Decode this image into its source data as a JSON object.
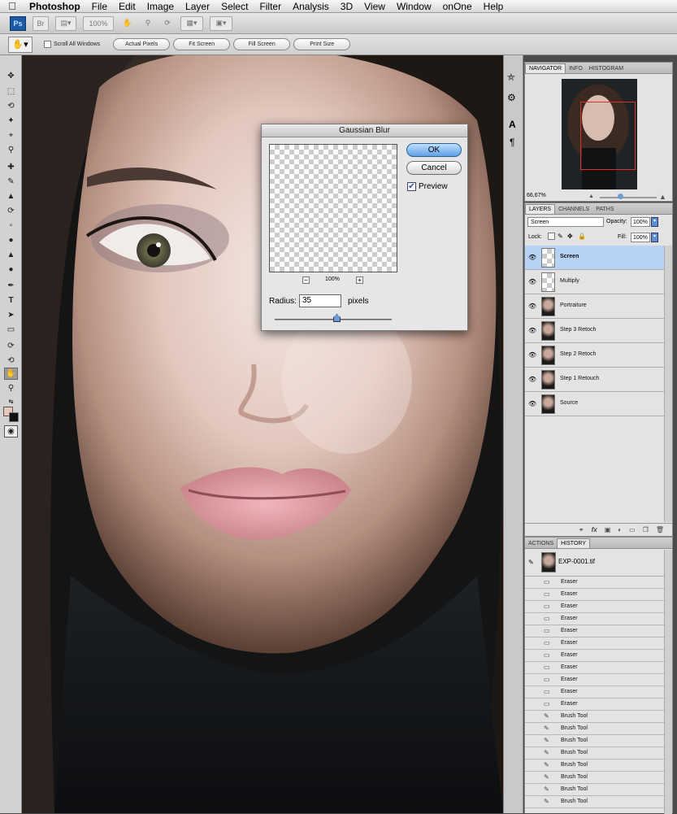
{
  "menubar": {
    "app": "Photoshop",
    "items": [
      "File",
      "Edit",
      "Image",
      "Layer",
      "Select",
      "Filter",
      "Analysis",
      "3D",
      "View",
      "Window",
      "onOne",
      "Help"
    ]
  },
  "appbar": {
    "logo": "Ps",
    "zoom": "100%"
  },
  "options": {
    "scroll_all": "Scroll All Windows",
    "actual_pixels": "Actual Pixels",
    "fit_screen": "Fit Screen",
    "fill_screen": "Fill Screen",
    "print_size": "Print Size"
  },
  "dialog": {
    "title": "Gaussian Blur",
    "ok": "OK",
    "cancel": "Cancel",
    "preview": "Preview",
    "zoom": "100%",
    "zoom_out": "−",
    "zoom_in": "+",
    "radius_label": "Radius:",
    "radius_value": "35",
    "radius_unit": "pixels"
  },
  "navigator": {
    "tabs": [
      "NAVIGATOR",
      "INFO",
      "HISTOGRAM"
    ],
    "zoom": "66,67%"
  },
  "layers": {
    "tabs": [
      "LAYERS",
      "CHANNELS",
      "PATHS"
    ],
    "blend_mode": "Screen",
    "opacity_label": "Opacity:",
    "opacity": "100%",
    "lock_label": "Lock:",
    "fill_label": "Fill:",
    "fill": "100%",
    "items": [
      {
        "name": "Screen",
        "selected": true,
        "thumb": "transparent"
      },
      {
        "name": "Multiply",
        "selected": false,
        "thumb": "transparent"
      },
      {
        "name": "Portraiture",
        "selected": false,
        "thumb": "photo"
      },
      {
        "name": "Step 3 Retoch",
        "selected": false,
        "thumb": "photo"
      },
      {
        "name": "Step 2 Retoch",
        "selected": false,
        "thumb": "photo"
      },
      {
        "name": "Step 1 Retouch",
        "selected": false,
        "thumb": "photo"
      },
      {
        "name": "Source",
        "selected": false,
        "thumb": "photo"
      }
    ]
  },
  "history": {
    "tabs": [
      "ACTIONS",
      "HISTORY"
    ],
    "snapshot": "EXP-0001.tif",
    "items": [
      {
        "name": "Eraser",
        "icon": "eraser-icon"
      },
      {
        "name": "Eraser",
        "icon": "eraser-icon"
      },
      {
        "name": "Eraser",
        "icon": "eraser-icon"
      },
      {
        "name": "Eraser",
        "icon": "eraser-icon"
      },
      {
        "name": "Eraser",
        "icon": "eraser-icon"
      },
      {
        "name": "Eraser",
        "icon": "eraser-icon"
      },
      {
        "name": "Eraser",
        "icon": "eraser-icon"
      },
      {
        "name": "Eraser",
        "icon": "eraser-icon"
      },
      {
        "name": "Eraser",
        "icon": "eraser-icon"
      },
      {
        "name": "Eraser",
        "icon": "eraser-icon"
      },
      {
        "name": "Eraser",
        "icon": "eraser-icon"
      },
      {
        "name": "Brush Tool",
        "icon": "brush-icon"
      },
      {
        "name": "Brush Tool",
        "icon": "brush-icon"
      },
      {
        "name": "Brush Tool",
        "icon": "brush-icon"
      },
      {
        "name": "Brush Tool",
        "icon": "brush-icon"
      },
      {
        "name": "Brush Tool",
        "icon": "brush-icon"
      },
      {
        "name": "Brush Tool",
        "icon": "brush-icon"
      },
      {
        "name": "Brush Tool",
        "icon": "brush-icon"
      },
      {
        "name": "Brush Tool",
        "icon": "brush-icon"
      }
    ]
  },
  "colors": {
    "selection": "#b7d2f5",
    "ok_button": "#7fb4f0",
    "nav_box": "#e0302a"
  }
}
